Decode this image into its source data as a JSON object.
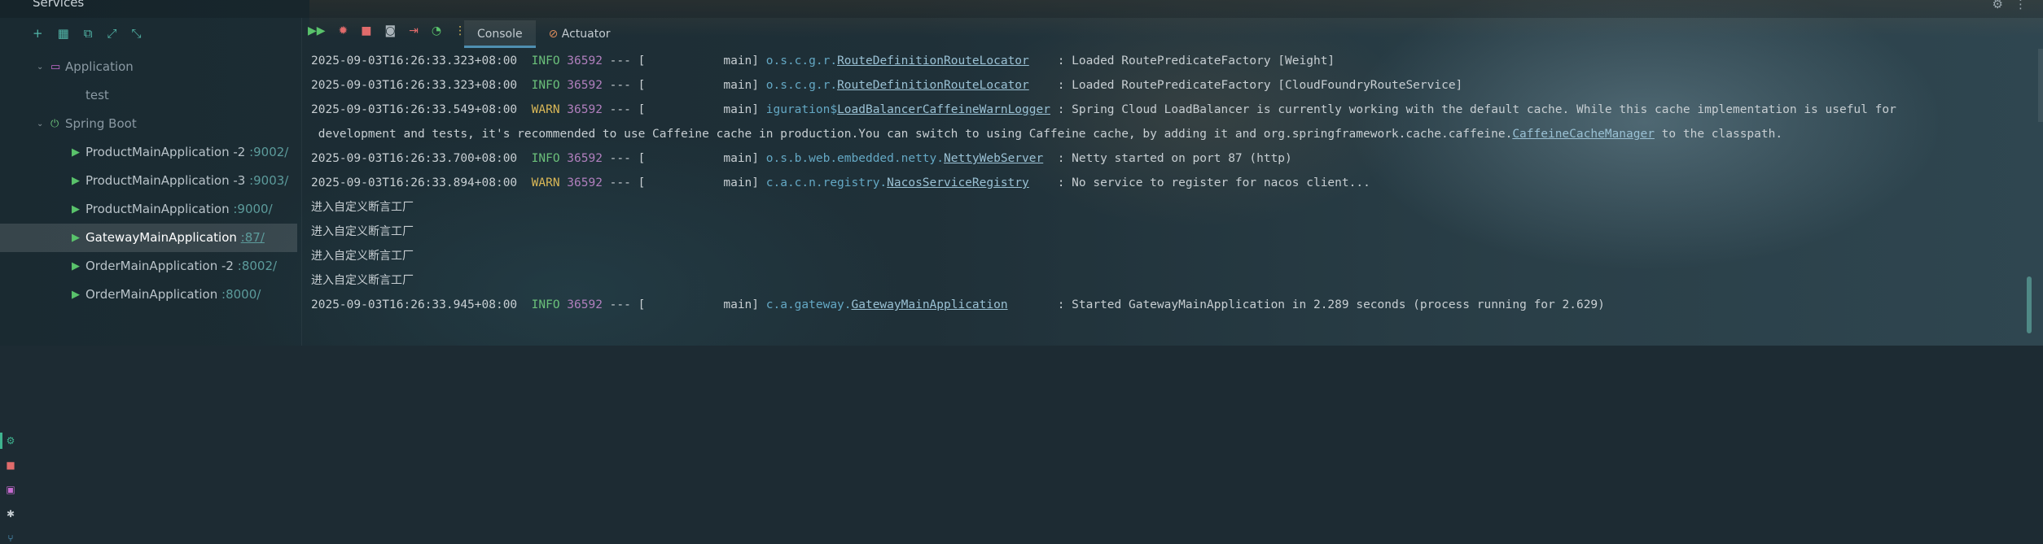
{
  "window": {
    "title": "Services"
  },
  "tree_toolbar": {
    "icons": [
      "plus-icon",
      "group-icon",
      "layout-icon",
      "expand-icon",
      "collapse-icon"
    ]
  },
  "tree": {
    "application_group": {
      "label": "Application"
    },
    "application_child": {
      "label": "test"
    },
    "spring_boot_group": {
      "label": "Spring Boot"
    },
    "services": [
      {
        "name": "ProductMainApplication -2",
        "port": ":9002/"
      },
      {
        "name": "ProductMainApplication -3",
        "port": ":9003/"
      },
      {
        "name": "ProductMainApplication",
        "port": ":9000/"
      },
      {
        "name": "GatewayMainApplication",
        "port": ":87/"
      },
      {
        "name": "OrderMainApplication -2",
        "port": ":8002/"
      },
      {
        "name": "OrderMainApplication",
        "port": ":8000/"
      }
    ]
  },
  "tabs": [
    {
      "label": "Console",
      "active": true
    },
    {
      "label": "Actuator",
      "active": false
    }
  ],
  "console": {
    "lines": [
      {
        "ts": "2025-09-03T16:26:33.323+08:00",
        "level": "INFO",
        "pid": "36592",
        "sep": " --- [",
        "thread": "           main] ",
        "pkg": "o.s.c.g.r.",
        "cls": "RouteDefinitionRouteLocator",
        "pad": "    ",
        "msg": ": Loaded RoutePredicateFactory [Weight]"
      },
      {
        "ts": "2025-09-03T16:26:33.323+08:00",
        "level": "INFO",
        "pid": "36592",
        "sep": " --- [",
        "thread": "           main] ",
        "pkg": "o.s.c.g.r.",
        "cls": "RouteDefinitionRouteLocator",
        "pad": "    ",
        "msg": ": Loaded RoutePredicateFactory [CloudFoundryRouteService]"
      },
      {
        "ts": "2025-09-03T16:26:33.549+08:00",
        "level": "WARN",
        "pid": "36592",
        "sep": " --- [",
        "thread": "           main] ",
        "pkg": "iguration$",
        "cls": "LoadBalancerCaffeineWarnLogger",
        "pad": " ",
        "msg": ": Spring Cloud LoadBalancer is currently working with the default cache. While this cache implementation is useful for"
      },
      {
        "continuation": " development and tests, it's recommended to use Caffeine cache in production.You can switch to using Caffeine cache, by adding it and org.springframework.cache.caffeine.",
        "continuation_cls": "CaffeineCacheManager",
        "continuation_tail": " to the classpath."
      },
      {
        "ts": "2025-09-03T16:26:33.700+08:00",
        "level": "INFO",
        "pid": "36592",
        "sep": " --- [",
        "thread": "           main] ",
        "pkg": "o.s.b.web.embedded.netty.",
        "cls": "NettyWebServer",
        "pad": "  ",
        "msg": ": Netty started on port 87 (http)"
      },
      {
        "ts": "2025-09-03T16:26:33.894+08:00",
        "level": "WARN",
        "pid": "36592",
        "sep": " --- [",
        "thread": "           main] ",
        "pkg": "c.a.c.n.registry.",
        "cls": "NacosServiceRegistry",
        "pad": "    ",
        "msg": ": No service to register for nacos client..."
      },
      {
        "text": "进入自定义断言工厂"
      },
      {
        "text": "进入自定义断言工厂"
      },
      {
        "text": "进入自定义断言工厂"
      },
      {
        "text": "进入自定义断言工厂"
      },
      {
        "ts": "2025-09-03T16:26:33.945+08:00",
        "level": "INFO",
        "pid": "36592",
        "sep": " --- [",
        "thread": "           main] ",
        "pkg": "c.a.gateway.",
        "cls": "GatewayMainApplication",
        "pad": "       ",
        "msg": ": Started GatewayMainApplication in 2.289 seconds (process running for 2.629)"
      }
    ]
  },
  "colors": {
    "info": "#6bc07a",
    "warn": "#d9b757",
    "pid": "#b07fbd",
    "class_link": "#64a8c4",
    "run_icon": "#59c26b",
    "selection": "#ffffff21"
  }
}
